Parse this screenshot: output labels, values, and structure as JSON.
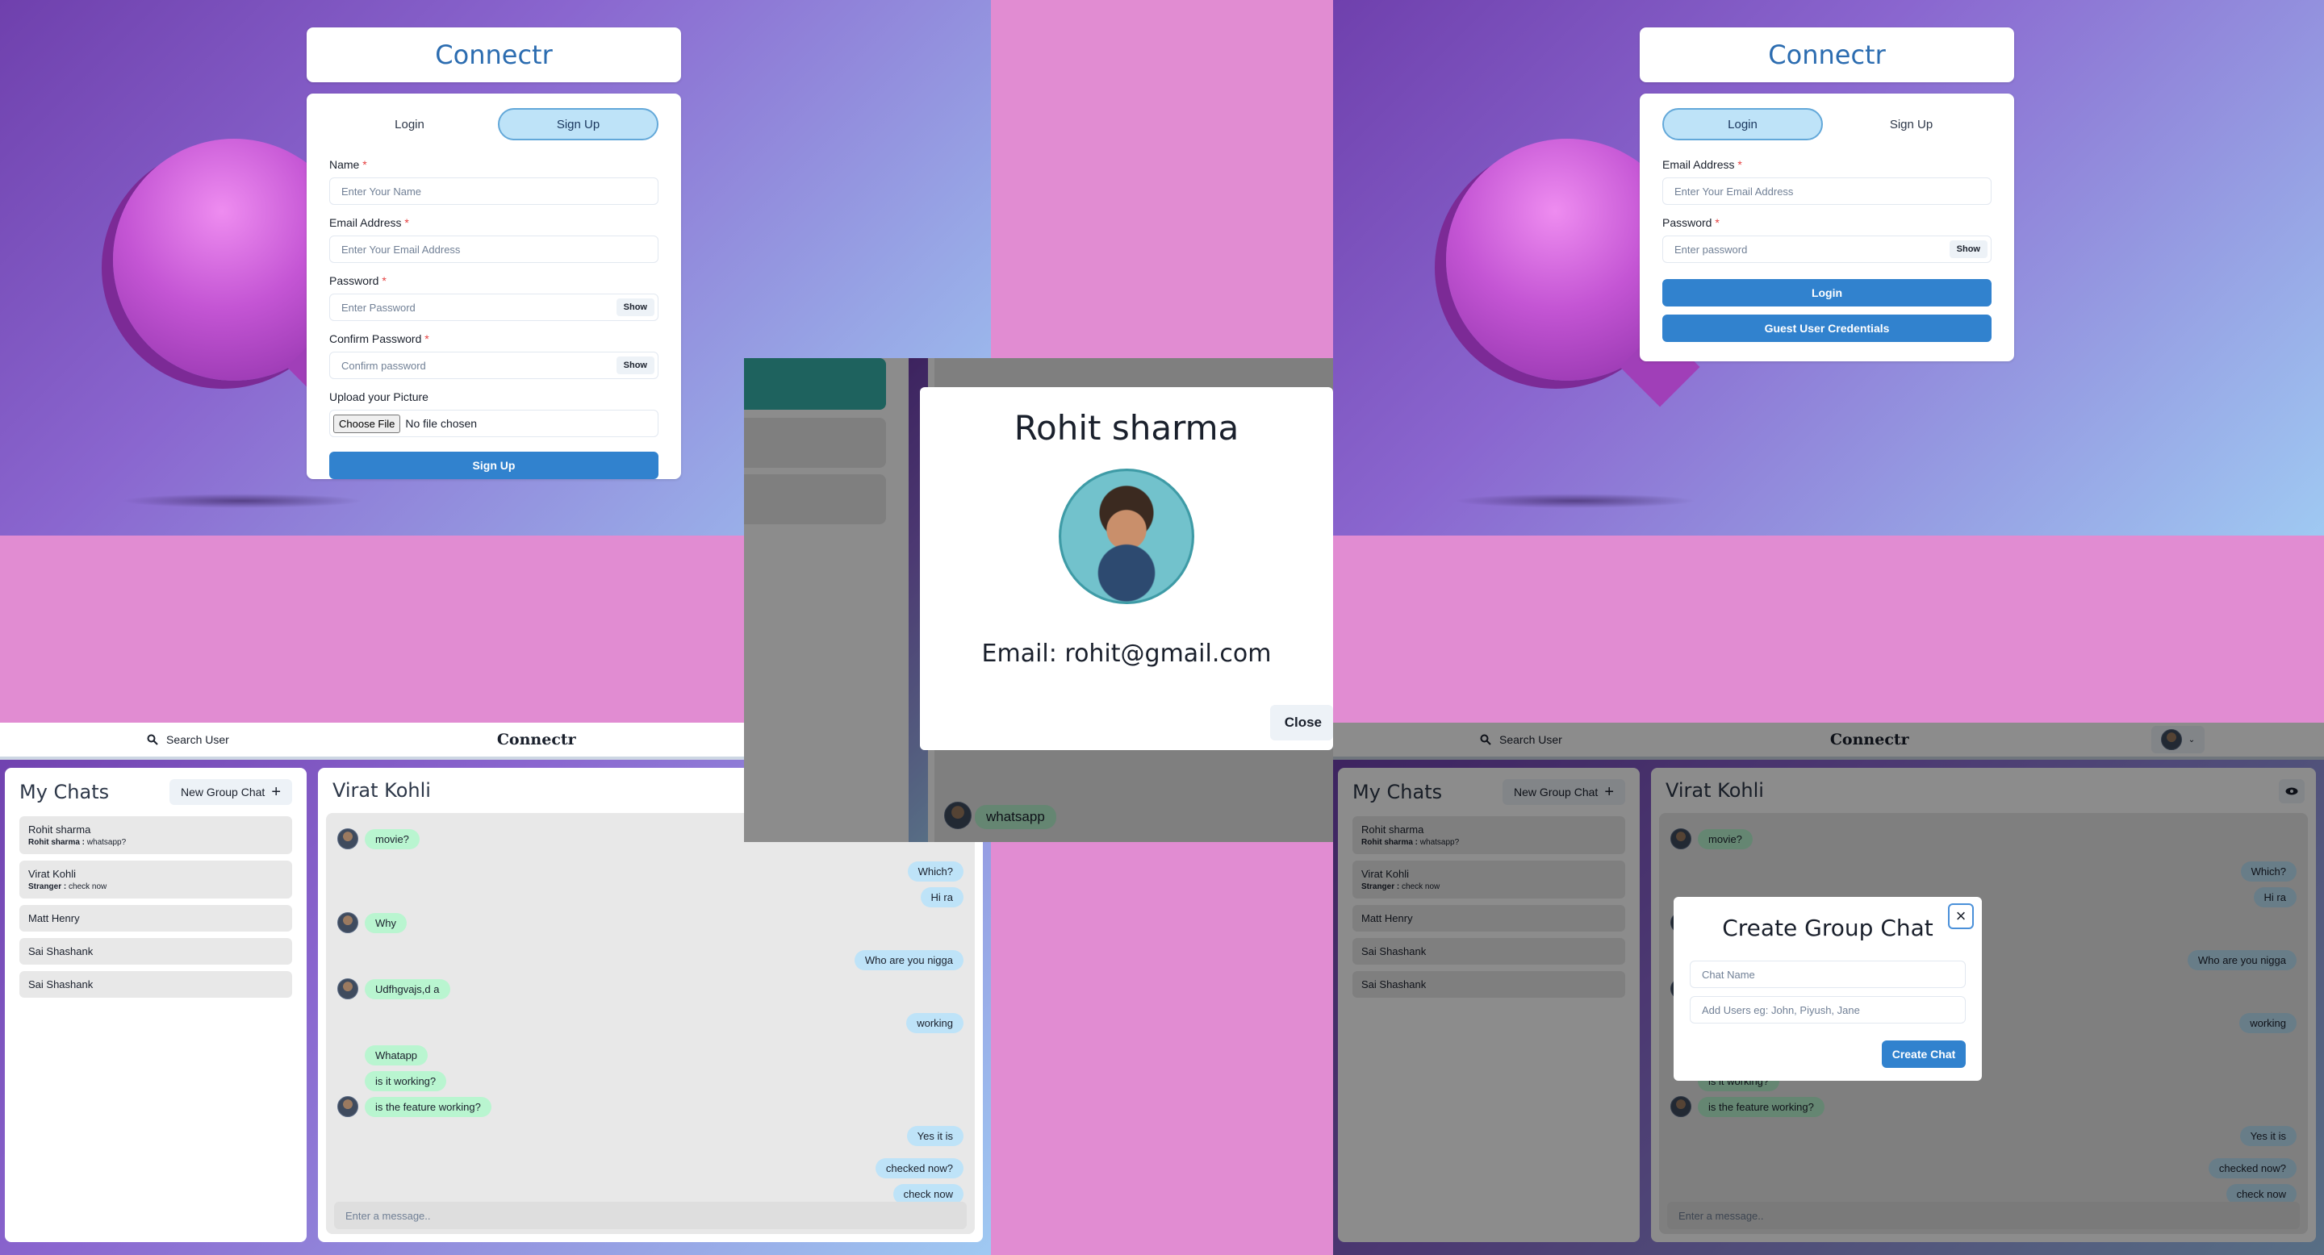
{
  "app_name": "Connectr",
  "signup_screen": {
    "tabs": [
      "Login",
      "Sign Up"
    ],
    "active_tab": "Sign Up",
    "fields": [
      {
        "label": "Name",
        "placeholder": "Enter Your Name"
      },
      {
        "label": "Email Address",
        "placeholder": "Enter Your Email Address"
      },
      {
        "label": "Password",
        "placeholder": "Enter Password",
        "toggle": "Show"
      },
      {
        "label": "Confirm Password",
        "placeholder": "Confirm password",
        "toggle": "Show"
      }
    ],
    "required_marker": "*",
    "upload_label": "Upload your Picture",
    "choose_file": "Choose File",
    "no_file": "No file chosen",
    "submit": "Sign Up"
  },
  "login_screen": {
    "tabs": [
      "Login",
      "Sign Up"
    ],
    "active_tab": "Login",
    "fields": [
      {
        "label": "Email Address",
        "placeholder": "Enter Your Email Address"
      },
      {
        "label": "Password",
        "placeholder": "Enter password",
        "toggle": "Show"
      }
    ],
    "submit": "Login",
    "guest": "Guest User Credentials"
  },
  "profile_modal": {
    "name": "Rohit sharma",
    "email": "Email: rohit@gmail.com",
    "close": "Close",
    "last_message": "whatsapp"
  },
  "chat_screen": {
    "search_label": "Search User",
    "sidebar_title": "My Chats",
    "new_group": "New Group Chat",
    "chats": [
      {
        "name": "Rohit sharma",
        "sender": "Rohit sharma :",
        "preview": "whatsapp?"
      },
      {
        "name": "Virat Kohli",
        "sender": "Stranger :",
        "preview": "check now"
      },
      {
        "name": "Matt Henry"
      },
      {
        "name": "Sai Shashank"
      },
      {
        "name": "Sai Shashank"
      }
    ],
    "active_chat": "Virat Kohli",
    "messages": [
      {
        "text": "movie?",
        "dir": "in",
        "avatar": true
      },
      {
        "text": "Which?",
        "dir": "out"
      },
      {
        "text": "Hi ra",
        "dir": "out"
      },
      {
        "text": "Why",
        "dir": "in",
        "avatar": true
      },
      {
        "text": "Who are you nigga",
        "dir": "out"
      },
      {
        "text": "Udfhgvajs,d a",
        "dir": "in",
        "avatar": true
      },
      {
        "text": "working",
        "dir": "out"
      },
      {
        "text": "Whatapp",
        "dir": "in"
      },
      {
        "text": "is it working?",
        "dir": "in"
      },
      {
        "text": "is the feature working?",
        "dir": "in",
        "avatar": true
      },
      {
        "text": "Yes it is",
        "dir": "out"
      },
      {
        "text": "checked now?",
        "dir": "out"
      },
      {
        "text": "check now",
        "dir": "out"
      }
    ],
    "message_placeholder": "Enter a message.."
  },
  "group_modal": {
    "title": "Create Group Chat",
    "chat_name_placeholder": "Chat Name",
    "users_placeholder": "Add Users eg: John, Piyush, Jane",
    "create": "Create Chat",
    "close_icon": "×"
  },
  "icons": {
    "search": "search-icon",
    "plus": "plus-icon",
    "eye": "eye-icon",
    "close": "close-icon",
    "chevron": "chevron-down-icon"
  },
  "colors": {
    "accent": "#3182ce",
    "brand_title": "#2b6cb0",
    "incoming": "#b9f5d0",
    "outgoing": "#bee3f8",
    "backdrop": "#e18cd2"
  }
}
